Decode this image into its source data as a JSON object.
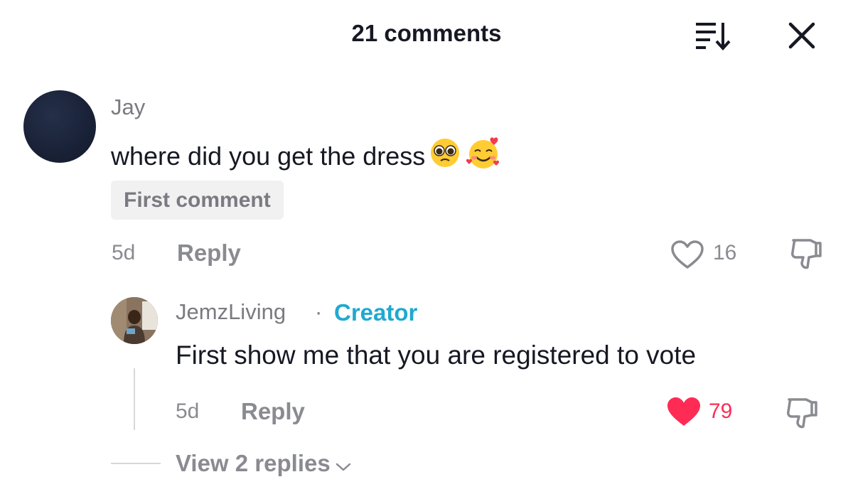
{
  "header": {
    "title": "21 comments",
    "sort_icon": "sort-icon",
    "close_icon": "close-icon"
  },
  "comments": [
    {
      "author": "Jay",
      "text": "where did you get the dress",
      "emojis": [
        "pleading-face-emoji",
        "smiling-face-with-hearts-emoji"
      ],
      "badge": "First comment",
      "time": "5d",
      "reply_label": "Reply",
      "likes": "16",
      "liked": false
    }
  ],
  "reply": {
    "author": "JemzLiving",
    "separator": "·",
    "role": "Creator",
    "text": "First show me that you are registered to vote",
    "time": "5d",
    "reply_label": "Reply",
    "likes": "79",
    "liked": true
  },
  "view_replies": {
    "label": "View 2 replies"
  },
  "colors": {
    "text": "#161823",
    "muted": "#8a8b91",
    "creator": "#20a9cf",
    "liked": "#fe2c55",
    "badge_bg": "#f1f1f2"
  }
}
